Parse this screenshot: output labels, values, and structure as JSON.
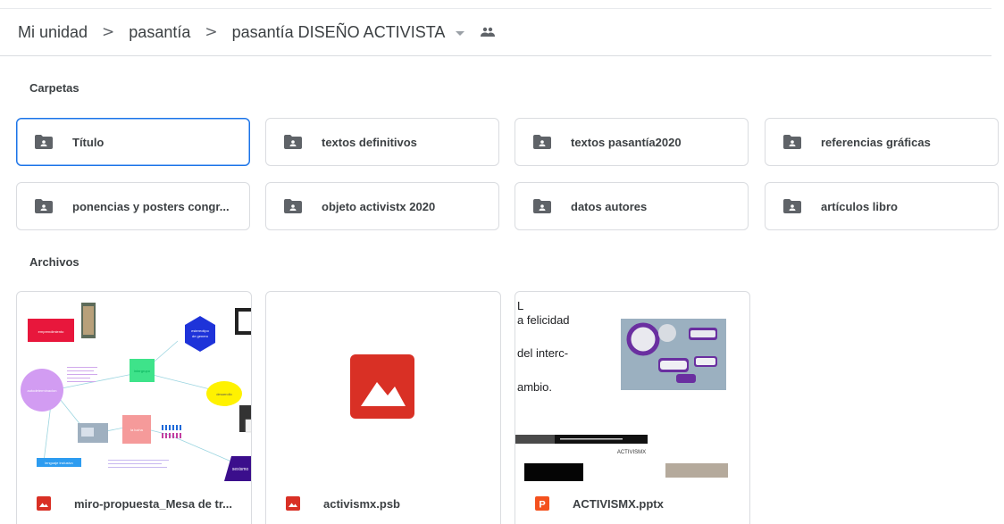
{
  "breadcrumb": {
    "items": [
      "Mi unidad",
      "pasantía",
      "pasantía DISEÑO ACTIVISTA"
    ],
    "separator": ">",
    "current_has_dropdown": true,
    "shared_icon": "people-icon"
  },
  "sections": {
    "folders_label": "Carpetas",
    "files_label": "Archivos"
  },
  "folders": [
    {
      "name": "Título",
      "selected": true
    },
    {
      "name": "textos definitivos"
    },
    {
      "name": "textos pasantía2020"
    },
    {
      "name": "referencias gráficas"
    },
    {
      "name": "ponencias y posters congr..."
    },
    {
      "name": "objeto activistx 2020"
    },
    {
      "name": "datos autores"
    },
    {
      "name": "artículos libro"
    }
  ],
  "files": [
    {
      "name": "miro-propuesta_Mesa de tr...",
      "type_icon": "image-icon"
    },
    {
      "name": "activismx.psb",
      "type_icon": "image-icon"
    },
    {
      "name": "ACTIVISMX.pptx",
      "type_icon": "slides-icon",
      "type_letter": "P"
    }
  ],
  "slide_preview": {
    "line1": "L",
    "line2": "a felicidad",
    "line3": "del interc-",
    "line4": "ambio.",
    "line5": "ACTIVISMX"
  },
  "colors": {
    "accent": "#1a73e8",
    "folder_icon": "#5f6368",
    "image_icon": "#d93025",
    "slides_icon": "#f4511e"
  }
}
